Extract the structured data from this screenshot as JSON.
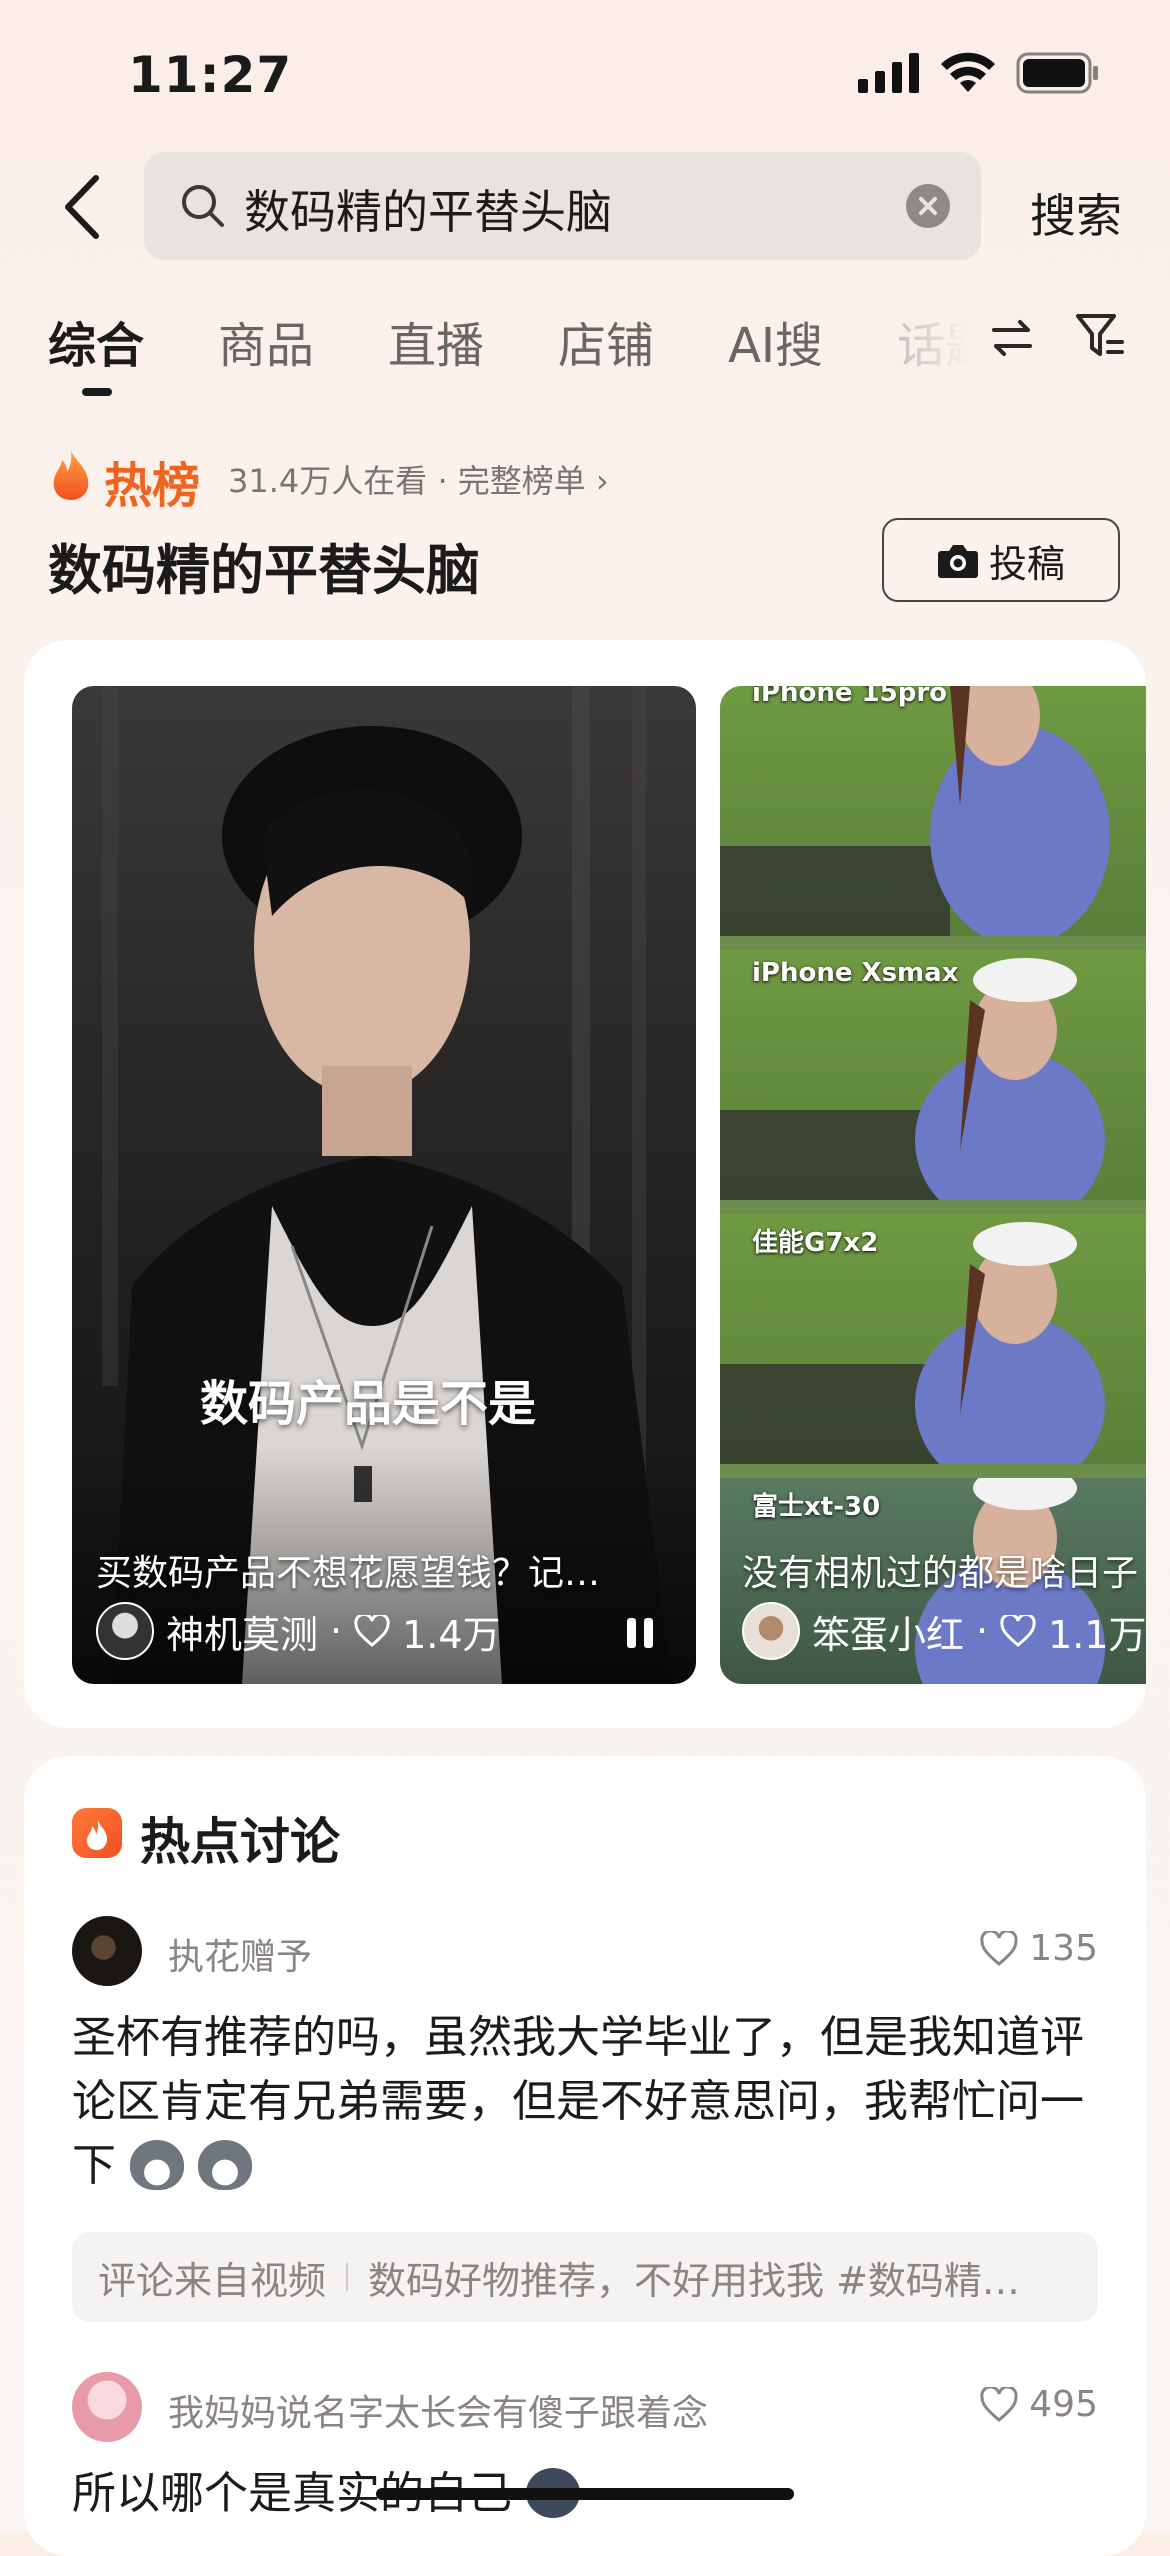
{
  "status_bar": {
    "time": "11:27"
  },
  "search": {
    "query": "数码精的平替头脑",
    "button": "搜索"
  },
  "tabs": [
    {
      "label": "综合",
      "active": true
    },
    {
      "label": "商品"
    },
    {
      "label": "直播"
    },
    {
      "label": "店铺"
    },
    {
      "label": "AI搜"
    },
    {
      "label": "话题"
    }
  ],
  "hot": {
    "label": "热榜",
    "viewers": "31.4万人在看",
    "full_list": "完整榜单",
    "title": "数码精的平替头脑",
    "post_button": "投稿"
  },
  "videos": [
    {
      "overlay": "数码产品是不是",
      "caption": "买数码产品不想花愿望钱？记…",
      "author": "神机莫测",
      "likes": "1.4万"
    },
    {
      "caption": "没有相机过的都是啥日子",
      "author": "笨蛋小红",
      "likes": "1.1万",
      "strip_labels": [
        "iPhone 15pro",
        "iPhone Xsmax",
        "佳能G7x2",
        "富士xt-30"
      ]
    }
  ],
  "discussion": {
    "title": "热点讨论",
    "comments": [
      {
        "user": "执花赠予",
        "likes": "135",
        "text": "圣杯有推荐的吗，虽然我大学毕业了，但是我知道评论区肯定有兄弟需要，但是不好意思问，我帮忙问一下"
      },
      {
        "user": "我妈妈说名字太长会有傻子跟着念",
        "likes": "495",
        "text": "所以哪个是真实的自己"
      }
    ],
    "source_label": "评论来自视频",
    "source_title": "数码好物推荐，不好用找我 #数码精…"
  }
}
